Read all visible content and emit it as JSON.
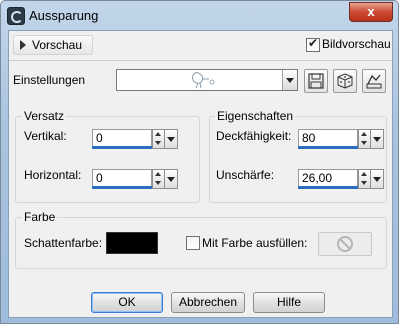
{
  "window": {
    "title": "Aussparung",
    "close_glyph": "x"
  },
  "toolbar": {
    "preview_label": "Vorschau",
    "image_preview_label": "Bildvorschau",
    "image_preview_checked": true
  },
  "presets": {
    "label": "Einstellungen",
    "value": ""
  },
  "offset": {
    "title": "Versatz",
    "vertical_label": "Vertikal:",
    "vertical_value": "0",
    "horizontal_label": "Horizontal:",
    "horizontal_value": "0"
  },
  "properties": {
    "title": "Eigenschaften",
    "opacity_label": "Deckfähigkeit:",
    "opacity_value": "80",
    "blur_label": "Unschärfe:",
    "blur_value": "26,00"
  },
  "color": {
    "title": "Farbe",
    "shadow_color_label": "Schattenfarbe:",
    "shadow_color": "#000000",
    "fill_with_color_label": "Mit Farbe ausfüllen:",
    "fill_with_color_checked": false
  },
  "buttons": {
    "ok": "OK",
    "cancel": "Abbrechen",
    "help": "Hilfe"
  },
  "icons": {
    "app": "app-icon",
    "save": "save-icon",
    "random": "dice-icon",
    "reset": "reset-icon",
    "disabled": "prohibited-icon"
  }
}
